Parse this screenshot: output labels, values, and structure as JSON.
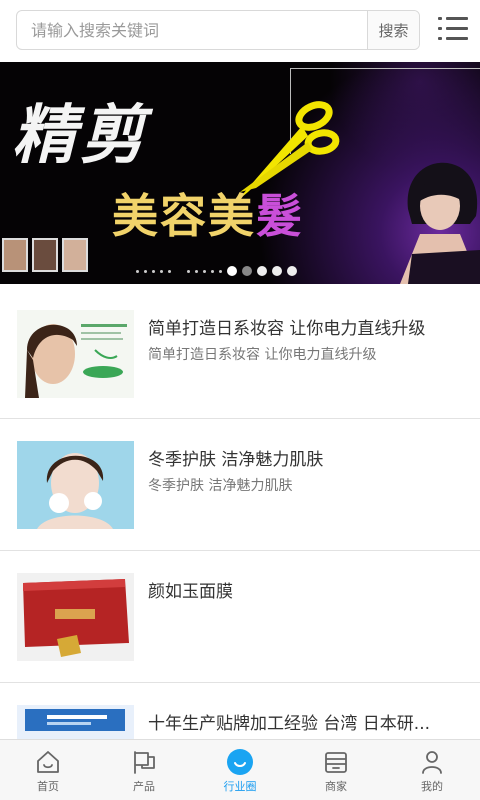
{
  "search": {
    "placeholder": "请输入搜索关键词",
    "button_label": "搜索"
  },
  "banner": {
    "title": "精剪",
    "subtitle_main": "美容美",
    "subtitle_accent": "髮",
    "slide_indicator": {
      "total": 5,
      "active": 1
    }
  },
  "articles": [
    {
      "title": "简单打造日系妆容 让你电力直线升级",
      "desc": "简单打造日系妆容 让你电力直线升级"
    },
    {
      "title": "冬季护肤 洁净魅力肌肤",
      "desc": "冬季护肤 洁净魅力肌肤"
    },
    {
      "title": "颜如玉面膜",
      "desc": ""
    },
    {
      "title": "十年生产贴牌加工经验 台湾 日本研...",
      "desc": ""
    }
  ],
  "tabbar": {
    "items": [
      {
        "label": "首页",
        "icon": "home-icon"
      },
      {
        "label": "产品",
        "icon": "flag-icon"
      },
      {
        "label": "行业圈",
        "icon": "circle-icon",
        "active": true
      },
      {
        "label": "商家",
        "icon": "store-icon"
      },
      {
        "label": "我的",
        "icon": "user-icon"
      }
    ]
  },
  "colors": {
    "accent": "#1aa4f2",
    "banner_bg": "#050305",
    "banner_gold": "#f1d36a",
    "banner_purple": "#c94fd9"
  }
}
